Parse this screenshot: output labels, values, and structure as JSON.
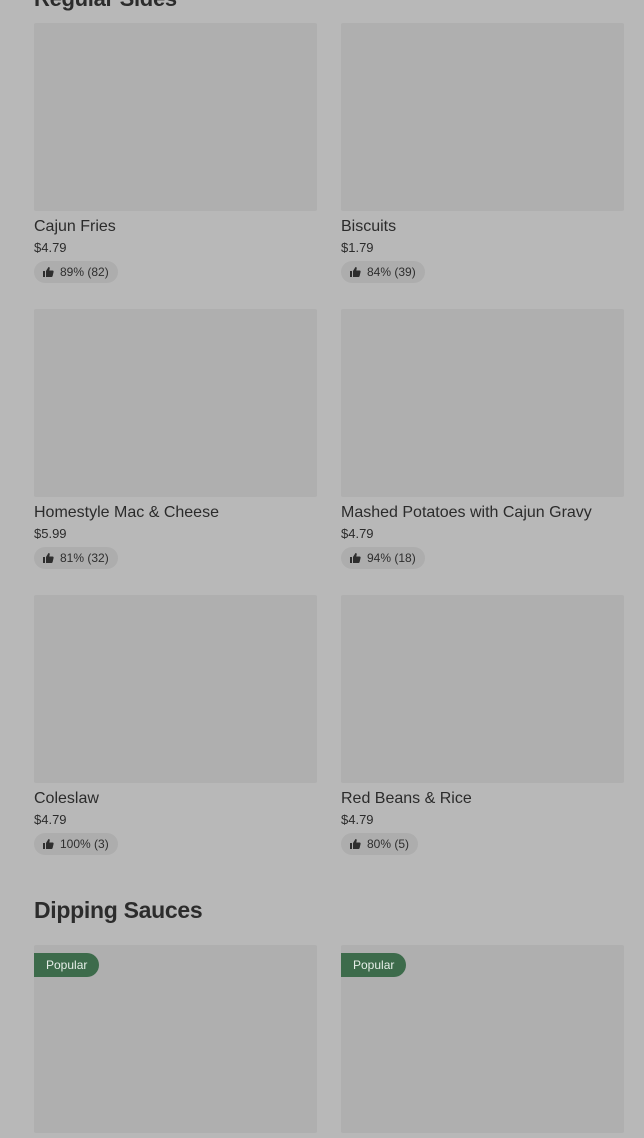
{
  "sections": {
    "sides_title": "Regular Sides",
    "sauces_title": "Dipping Sauces"
  },
  "sides": [
    {
      "name": "Cajun Fries",
      "price": "$4.79",
      "rating": "89% (82)"
    },
    {
      "name": "Biscuits",
      "price": "$1.79",
      "rating": "84% (39)"
    },
    {
      "name": "Homestyle Mac & Cheese",
      "price": "$5.99",
      "rating": "81% (32)"
    },
    {
      "name": "Mashed Potatoes with Cajun Gravy",
      "price": "$4.79",
      "rating": "94% (18)"
    },
    {
      "name": "Coleslaw",
      "price": "$4.79",
      "rating": "100% (3)"
    },
    {
      "name": "Red Beans & Rice",
      "price": "$4.79",
      "rating": "80% (5)"
    }
  ],
  "sauces": [
    {
      "badge": "Popular"
    },
    {
      "badge": "Popular"
    }
  ],
  "icons": {
    "rating": "thumbs-up-icon"
  },
  "colors": {
    "badge_bg": "#3d6b4b",
    "overlay_bg": "#b8b8b8"
  }
}
